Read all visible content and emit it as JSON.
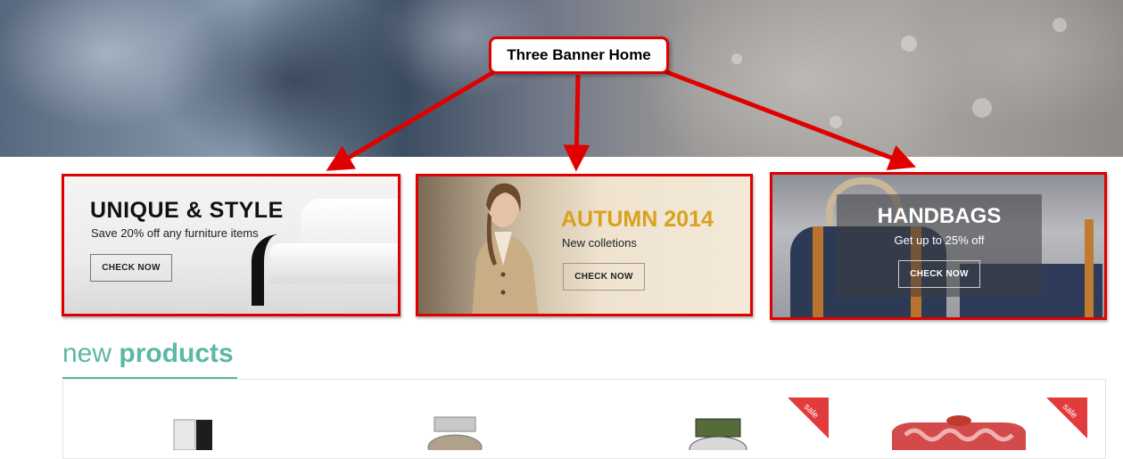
{
  "callout": {
    "label": "Three Banner Home"
  },
  "banners": [
    {
      "title": "UNIQUE & STYLE",
      "subtitle": "Save 20% off any furniture items",
      "button": "CHECK NOW"
    },
    {
      "title": "AUTUMN 2014",
      "subtitle": "New colletions",
      "button": "CHECK NOW"
    },
    {
      "title": "HANDBAGS",
      "subtitle": "Get up to 25% off",
      "button": "CHECK NOW"
    }
  ],
  "new_products": {
    "title_light": "new",
    "title_bold": "products"
  },
  "products": [
    {
      "image": "kitchen-appliance"
    },
    {
      "image": "metal-watch"
    },
    {
      "image": "green-strap-watch",
      "badge": "sale"
    },
    {
      "image": "red-handbag",
      "badge": "sale"
    }
  ],
  "colors": {
    "accent": "#5cb8a4",
    "annotation": "#e00000",
    "sale": "#e23b3b",
    "autumn": "#d9a21d"
  }
}
